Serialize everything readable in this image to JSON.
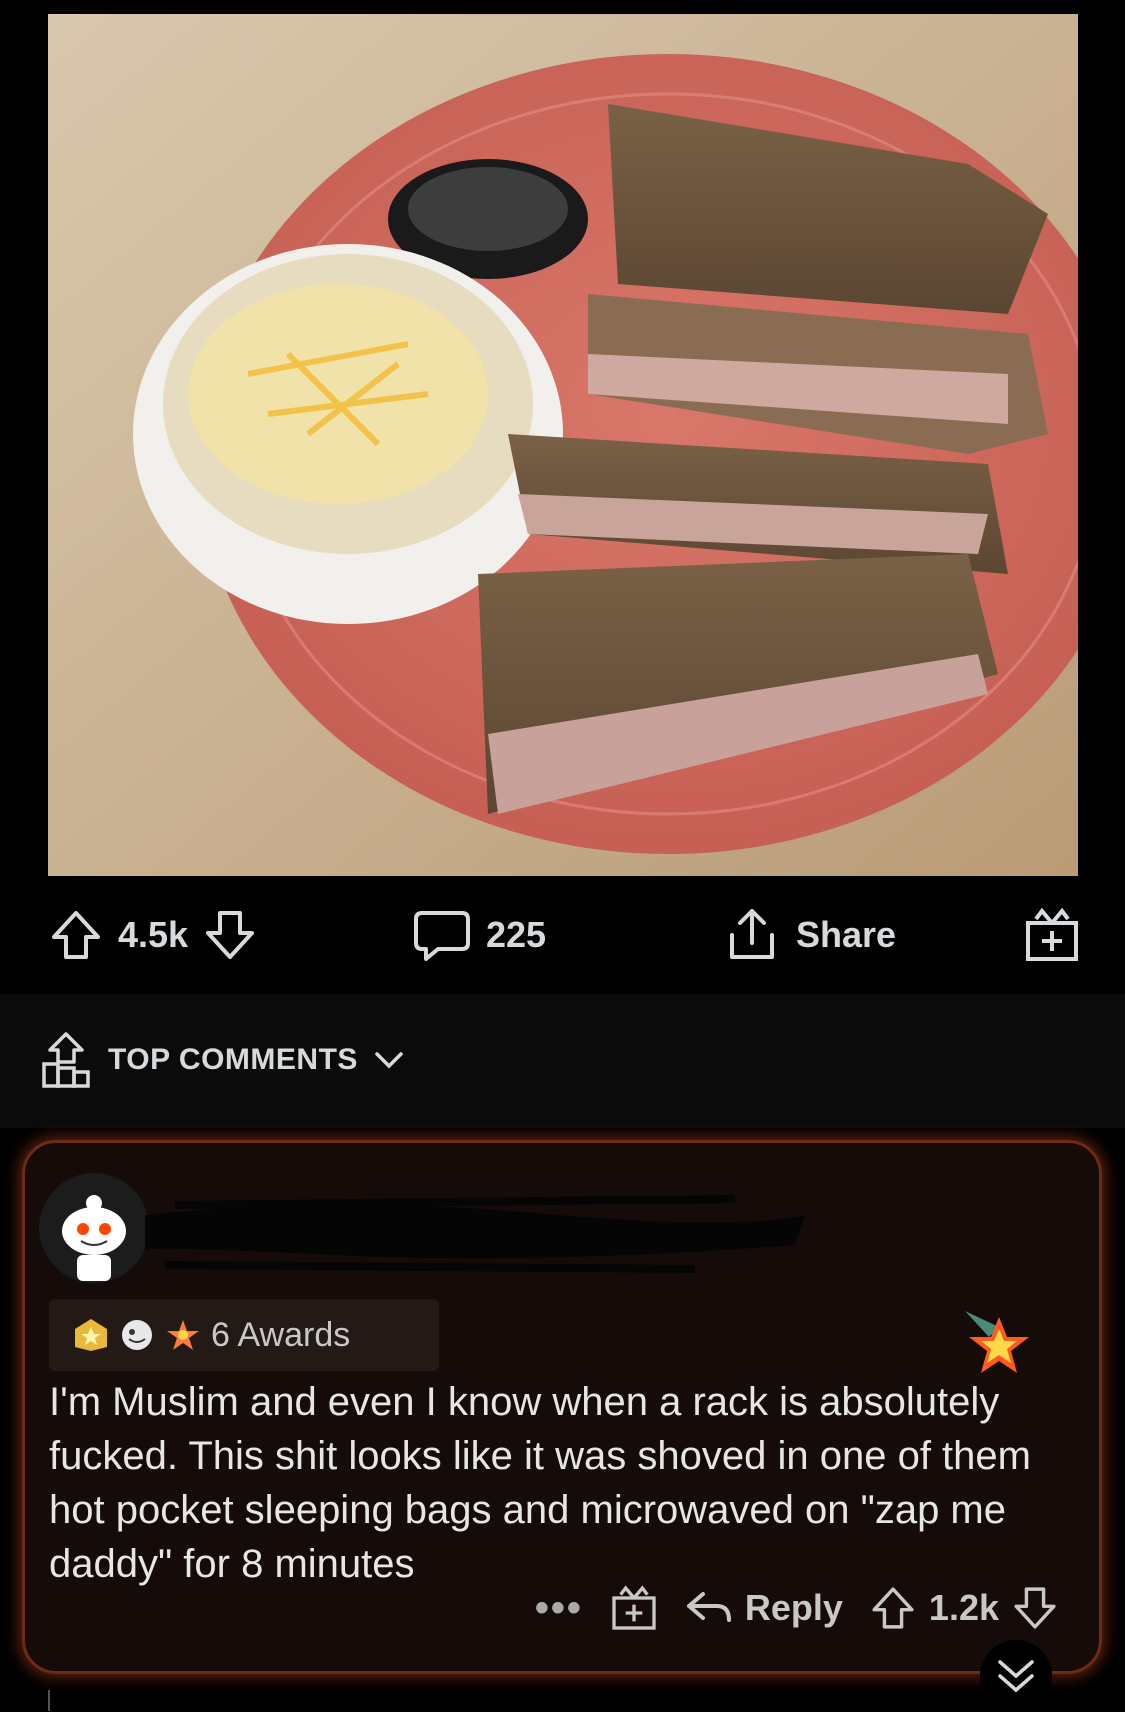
{
  "post": {
    "image_alt": "Plate of ribs with mac and cheese",
    "actions": {
      "upvotes": "4.5k",
      "comments": "225",
      "share_label": "Share"
    }
  },
  "sort": {
    "label": "TOP COMMENTS"
  },
  "comment": {
    "awards_label": "6 Awards",
    "body": "I'm Muslim and even I know when a rack is absolutely fucked. This shit looks like it was shoved in one of them hot pocket sleeping bags and microwaved on \"zap me daddy\" for 8 minutes",
    "reply_label": "Reply",
    "score": "1.2k"
  },
  "colors": {
    "comment_glow": "#6e2a18",
    "background": "#000000",
    "text": "#d7dadc"
  },
  "icons": [
    "upvote-icon",
    "downvote-icon",
    "comment-icon",
    "share-icon",
    "award-icon",
    "trophy-icon",
    "chevron-down-icon",
    "snoo-avatar",
    "star-award-icon",
    "more-icon",
    "reply-icon"
  ]
}
